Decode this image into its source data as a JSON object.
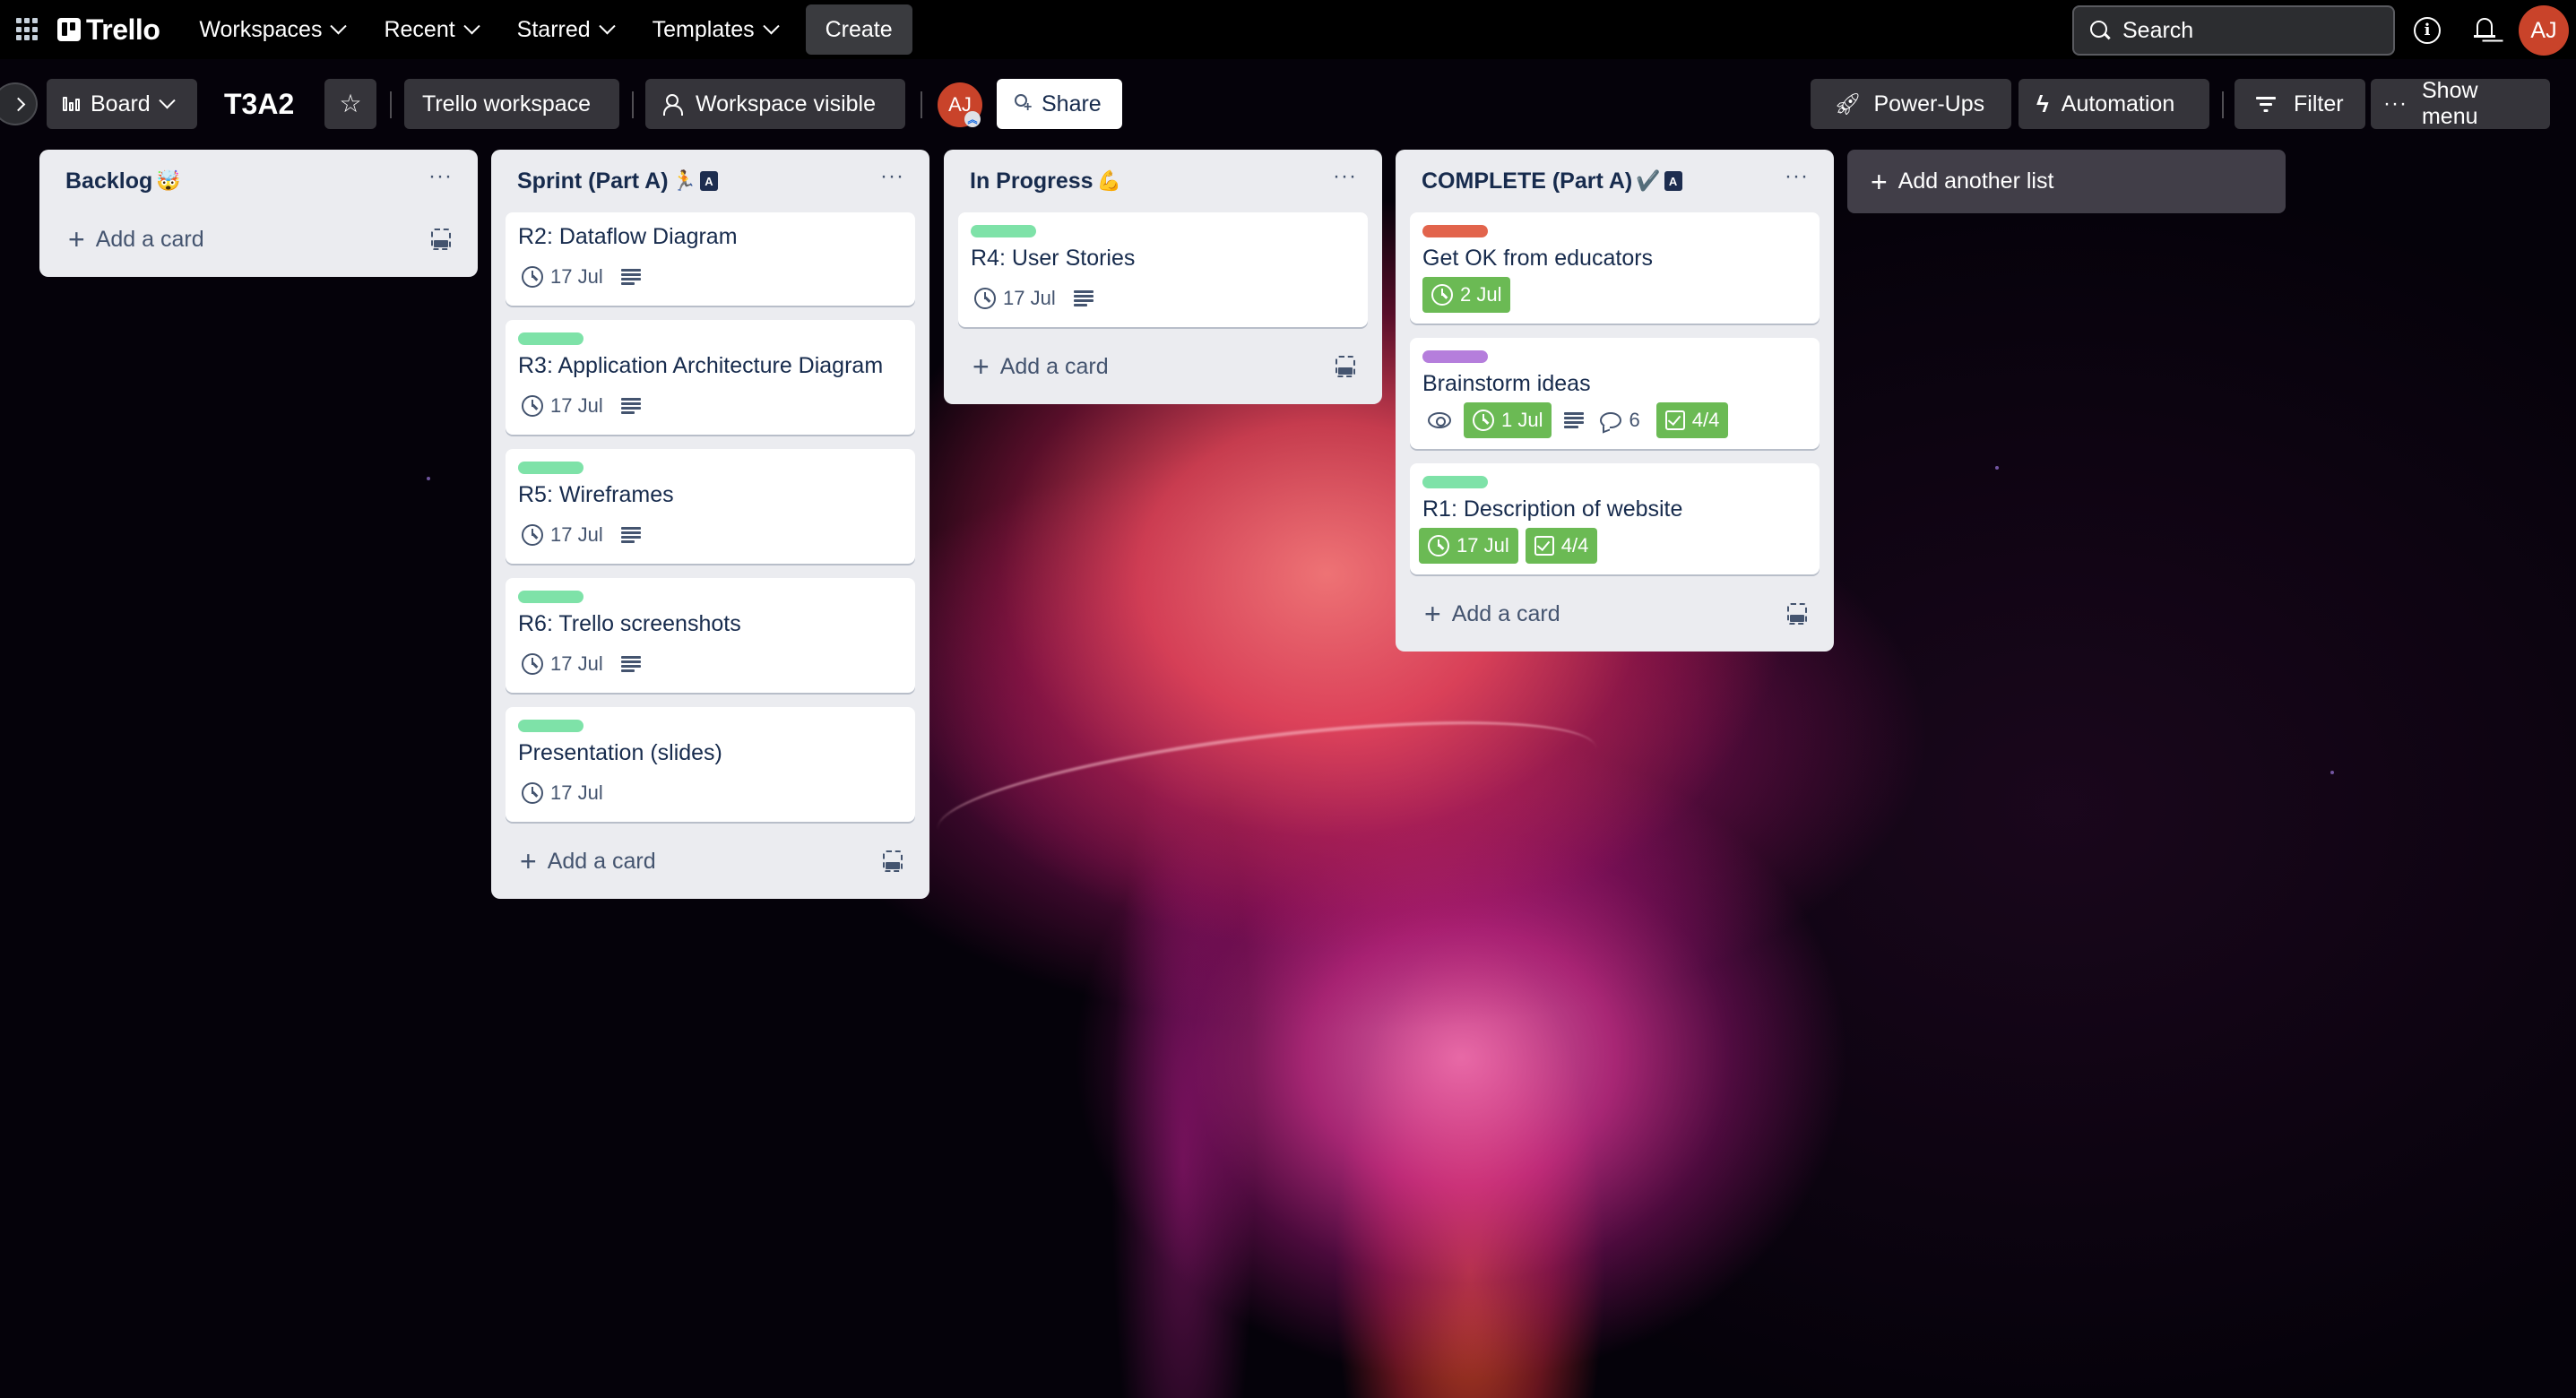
{
  "topnav": {
    "logo": "Trello",
    "items": [
      {
        "label": "Workspaces"
      },
      {
        "label": "Recent"
      },
      {
        "label": "Starred"
      },
      {
        "label": "Templates"
      }
    ],
    "create_label": "Create",
    "search_placeholder": "Search",
    "user_initials": "AJ"
  },
  "board_header": {
    "view_label": "Board",
    "title": "T3A2",
    "workspace_label": "Trello workspace",
    "visibility_label": "Workspace visible",
    "member_initials": "AJ",
    "share_label": "Share",
    "powerups_label": "Power-Ups",
    "automation_label": "Automation",
    "filter_label": "Filter",
    "show_menu_label": "Show menu"
  },
  "colors": {
    "label_green": "#7ee2a8",
    "label_red": "#e2644c",
    "label_purple": "#b57edc",
    "badge_green": "#6bba54",
    "avatar": "#c9432a"
  },
  "lists": [
    {
      "title": "Backlog",
      "emoji": "🤯",
      "badge": "",
      "add_card_label": "Add a card",
      "cards": []
    },
    {
      "title": "Sprint (Part A)",
      "emoji": "🏃",
      "badge": "A",
      "add_card_label": "Add a card",
      "cards": [
        {
          "title": "R2: Dataflow Diagram",
          "label": null,
          "due": "17 Jul"
        },
        {
          "title": "R3: Application Architecture Diagram",
          "label": "green",
          "due": "17 Jul"
        },
        {
          "title": "R5: Wireframes",
          "label": "green",
          "due": "17 Jul"
        },
        {
          "title": "R6: Trello screenshots",
          "label": "green",
          "due": "17 Jul"
        },
        {
          "title": "Presentation (slides)",
          "label": "green",
          "due": "17 Jul"
        }
      ]
    },
    {
      "title": "In Progress",
      "emoji": "💪",
      "badge": "",
      "add_card_label": "Add a card",
      "cards": [
        {
          "title": "R4: User Stories",
          "label": "green",
          "due": "17 Jul"
        }
      ]
    },
    {
      "title": "COMPLETE (Part A)",
      "emoji": "✔️",
      "badge": "A",
      "add_card_label": "Add a card",
      "cards": [
        {
          "title": "Get OK from educators",
          "label": "red",
          "due": "2 Jul"
        },
        {
          "title": "Brainstorm ideas",
          "label": "purple",
          "due": "1 Jul",
          "comments": "6",
          "checklist": "4/4"
        },
        {
          "title": "R1: Description of website",
          "label": "green",
          "due": "17 Jul",
          "checklist": "4/4"
        }
      ]
    }
  ],
  "add_list_label": "Add another list"
}
